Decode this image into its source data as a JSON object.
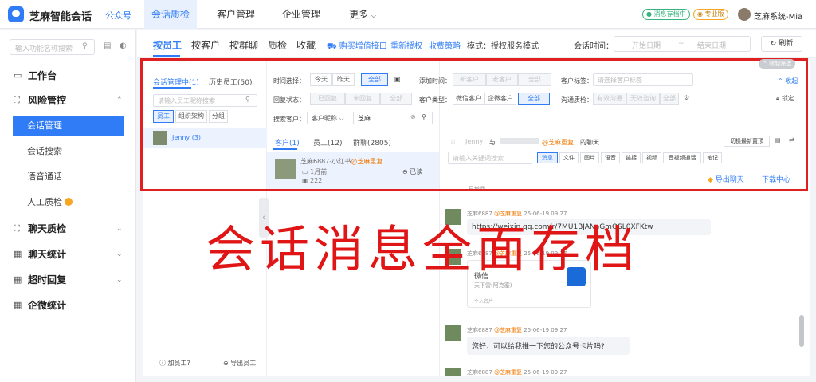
{
  "topbar": {
    "app_title": "芝麻智能会话",
    "official_account": "公众号",
    "nav": [
      "会话质检",
      "客户管理",
      "企业管理",
      "更多"
    ],
    "store_status": "消息存档中",
    "plan": "专业版",
    "user": "芝麻系统-Mia"
  },
  "sidebar": {
    "search_placeholder": "输入功能名称搜索",
    "menu": {
      "workbench": "工作台",
      "risk": "风险管控",
      "session_mgmt": "会话管理",
      "session_search": "会话搜索",
      "voice": "语音通话",
      "manual_qc": "人工质检",
      "chat_qc": "聊天质检",
      "chat_stats": "聊天统计",
      "timeout": "超时回复",
      "wecom_stats": "企微统计"
    }
  },
  "toolbar": {
    "tabs": [
      "按员工",
      "按客户",
      "按群聊",
      "质检",
      "收藏"
    ],
    "buy_link": "购买增值接口",
    "reauth_link": "重新授权",
    "fee_link": "收费策略",
    "mode": "模式：授权服务模式",
    "time_label": "会话时间：",
    "start_date": "开始日期",
    "date_sep": "~",
    "end_date": "结束日期",
    "refresh": "刷新"
  },
  "left_panel": {
    "tab_active": "会话管理中(1)",
    "tab_history": "历史员工(50)",
    "search_placeholder": "请输入员工昵称搜索",
    "filters": [
      "员工",
      "组织架构",
      "分组"
    ],
    "employee": "Jenny",
    "employee_count": "(3)",
    "add_employee": "加员工?",
    "export_employee": "导出员工"
  },
  "filter_bar": {
    "time_label": "时间选择：",
    "time_options": [
      "今天",
      "昨天",
      "全部"
    ],
    "add_time_label": "添加时间：",
    "add_time_options": [
      "新客户",
      "老客户",
      "全部"
    ],
    "tag_label": "客户标签：",
    "tag_placeholder": "请选择客户标签",
    "collapse": "收起",
    "reply_label": "回复状态：",
    "reply_options": [
      "已回复",
      "未回复",
      "全部"
    ],
    "type_label": "客户类型：",
    "type_options": [
      "微信客户",
      "企微客户",
      "全部"
    ],
    "qc_label": "沟通质检：",
    "qc_options": [
      "有效沟通",
      "无效咨询",
      "全部"
    ],
    "lock": "锁定",
    "search_label": "搜索客户：",
    "search_field": "客户昵称",
    "search_value": "芝麻",
    "collapse_filter": "收起筛选"
  },
  "mid_panel": {
    "tabs": [
      "客户(1)",
      "员工(12)",
      "群聊(2805)"
    ],
    "conv_name": "芝麻6887-小红书",
    "conv_tag": "@芝麻重复",
    "conv_time": "1月前",
    "conv_count": "222",
    "conv_status": "已读"
  },
  "chat": {
    "employee": "Jenny",
    "with": "与",
    "customer_tag": "@芝麻重复",
    "chat_suffix": "的聊天",
    "switch_latest": "切换最新置顶",
    "search_placeholder": "请输入关键词搜索",
    "msg_filters": [
      "消息",
      "文件",
      "图片",
      "语音",
      "链接",
      "视频",
      "音视频通话",
      "笔记"
    ],
    "export_chat": "导出聊天",
    "download_center": "下载中心",
    "recall_text": "已撤回",
    "messages": [
      {
        "sender": "芝麻6887",
        "tag": "@芝麻重复",
        "time": "25-06-19 09:27",
        "text": "https://weixin.qq.com/r/7MU1BJANaGmOSL0XFKtw"
      },
      {
        "sender": "芝麻6887",
        "tag": "@芝麻重复",
        "time": "25-06-19 09:27",
        "card_title": "微信",
        "card_sub": "天下雷(阿克塞)",
        "card_foot": "个人名片"
      },
      {
        "sender": "芝麻6887",
        "tag": "@芝麻重复",
        "time": "25-06-19 09:27",
        "text": "您好，可以给我推一下您的公众号卡片吗?"
      },
      {
        "sender": "芝麻6887",
        "tag": "@芝麻重复",
        "time": "25-06-19 09:27",
        "text": ""
      }
    ]
  },
  "overlay": {
    "title": "会话消息全面存档"
  }
}
